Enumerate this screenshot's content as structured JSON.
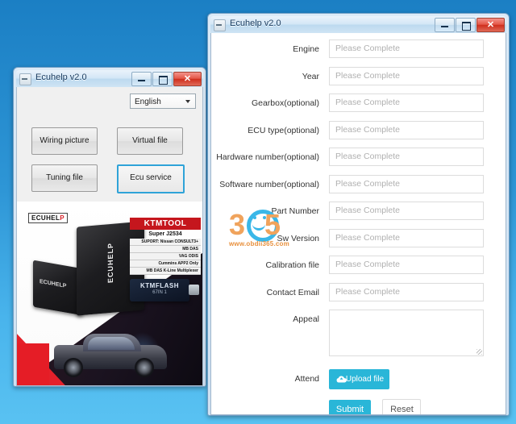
{
  "desktop": {
    "background_color": "#2e96d6"
  },
  "left_window": {
    "title": "Ecuhelp v2.0",
    "window_controls": {
      "minimize": "minimize-icon",
      "maximize": "maximize-icon",
      "close": "✕"
    },
    "language_select": {
      "value": "English",
      "options": [
        "English"
      ]
    },
    "buttons": [
      {
        "id": "wiring",
        "label": "Wiring picture",
        "active": false
      },
      {
        "id": "virtual",
        "label": "Virtual file",
        "active": false
      },
      {
        "id": "tuning",
        "label": "Tuning file",
        "active": false
      },
      {
        "id": "ecu",
        "label": "Ecu service",
        "active": true
      }
    ],
    "banner": {
      "brand": "ECUHELP",
      "brand_prefix": "ECUHEL",
      "brand_suffix": "P",
      "device_label": "ECUHELP",
      "device_side_label": "ECUHELP",
      "product_title": "KTMTOOL",
      "product_title_main": "KTM",
      "product_title_sub": "TOOL",
      "product_sub": "Super  J2534",
      "spec_rows": [
        "SUPORT:  Nissan CONSULT3+",
        "MB DAS",
        "VAG ODIS",
        "Cummins APP2 Only",
        "MB DAS K-Line Multiplexer"
      ],
      "usb_title": "KTMFLASH",
      "usb_sub": "67IN 1"
    }
  },
  "right_window": {
    "title": "Ecuhelp v2.0",
    "window_controls": {
      "minimize": "minimize-icon",
      "maximize": "maximize-icon",
      "close": "✕"
    },
    "placeholder": "Please Complete",
    "fields": [
      {
        "label": "Engine",
        "value": "",
        "placeholder": "Please Complete",
        "type": "text"
      },
      {
        "label": "Year",
        "value": "",
        "placeholder": "Please Complete",
        "type": "text"
      },
      {
        "label": "Gearbox(optional)",
        "value": "",
        "placeholder": "Please Complete",
        "type": "text"
      },
      {
        "label": "ECU type(optional)",
        "value": "",
        "placeholder": "Please Complete",
        "type": "text"
      },
      {
        "label": "Hardware number(optional)",
        "value": "",
        "placeholder": "Please Complete",
        "type": "text"
      },
      {
        "label": "Software number(optional)",
        "value": "",
        "placeholder": "Please Complete",
        "type": "text"
      },
      {
        "label": "Part Number",
        "value": "",
        "placeholder": "Please Complete",
        "type": "text"
      },
      {
        "label": "Sw Version",
        "value": "",
        "placeholder": "Please Complete",
        "type": "text"
      },
      {
        "label": "Calibration file",
        "value": "",
        "placeholder": "Please Complete",
        "type": "text"
      },
      {
        "label": "Contact Email",
        "value": "",
        "placeholder": "Please Complete",
        "type": "text"
      },
      {
        "label": "Appeal",
        "value": "",
        "placeholder": "",
        "type": "textarea"
      }
    ],
    "attend_label": "Attend",
    "upload_label": "Upload file",
    "submit_label": "Submit",
    "reset_label": "Reset",
    "accent_color": "#29b6d8"
  },
  "watermark": {
    "digit_left": "3",
    "digit_right": "5",
    "url": "www.obdii365.com",
    "color_orange": "#f0a35c",
    "color_blue": "#3ab7e8"
  }
}
